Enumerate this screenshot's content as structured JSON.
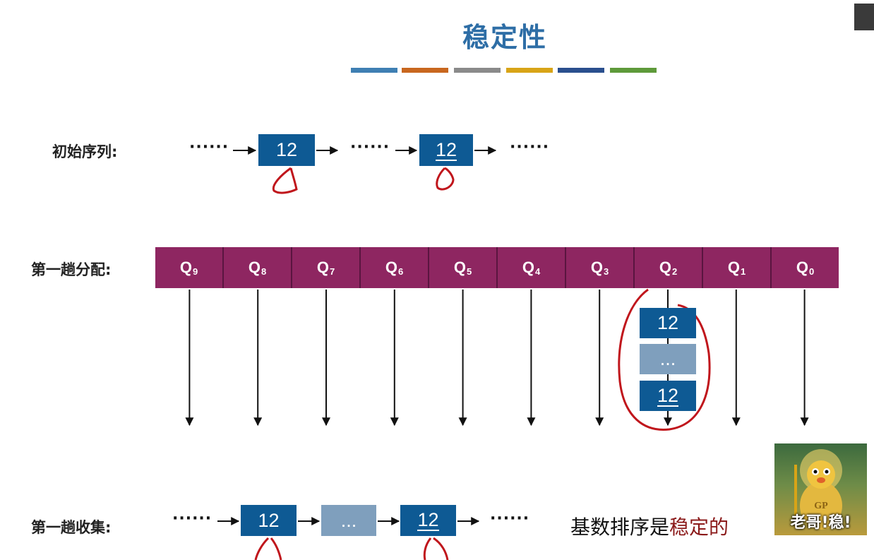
{
  "title": "稳定性",
  "swatch_colors": [
    "#3f7fb3",
    "#c8671f",
    "#8a8a8a",
    "#d8a417",
    "#2a4f8e",
    "#5e9a3a"
  ],
  "rows": {
    "initial": {
      "label": "初始序列:",
      "dots": "······",
      "box1": "12",
      "box2": "12"
    },
    "distribute": {
      "label": "第一趟分配:"
    },
    "collect": {
      "label": "第一趟收集:",
      "dots": "······",
      "box1": "12",
      "middle": "...",
      "box2": "12"
    }
  },
  "queues": [
    {
      "name": "Q",
      "index": "9"
    },
    {
      "name": "Q",
      "index": "8"
    },
    {
      "name": "Q",
      "index": "7"
    },
    {
      "name": "Q",
      "index": "6"
    },
    {
      "name": "Q",
      "index": "5"
    },
    {
      "name": "Q",
      "index": "4"
    },
    {
      "name": "Q",
      "index": "3"
    },
    {
      "name": "Q",
      "index": "2"
    },
    {
      "name": "Q",
      "index": "1"
    },
    {
      "name": "Q",
      "index": "0"
    }
  ],
  "q2_stack": {
    "top": "12",
    "middle": "...",
    "bottom": "12"
  },
  "conclusion": {
    "prefix": "基数排序是",
    "highlight": "稳定的"
  },
  "sticker_text": "老哥!稳!"
}
